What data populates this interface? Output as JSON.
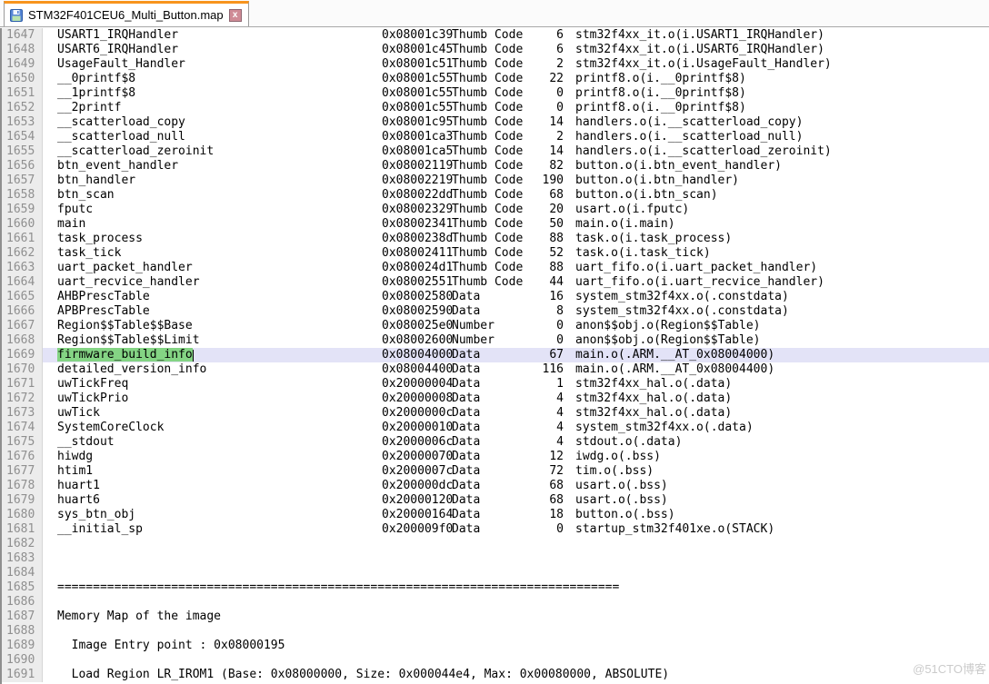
{
  "tab": {
    "title": "STM32F401CEU6_Multi_Button.map",
    "file_icon": "floppy-disk-icon",
    "close_icon": "close-x-icon",
    "close_glyph": "x",
    "accent_color": "#f7941d"
  },
  "colors": {
    "tab_accent_orange": "#f7941d",
    "selection_green": "#84d484",
    "current_line_lavender": "#e3e3f7",
    "gutter_bg": "#ececec",
    "gutter_text": "#8f8f8f",
    "close_button_pink": "#cf8b96",
    "watermark_gray": "#cbcbcb"
  },
  "editor": {
    "first_line": 1647,
    "last_line": 1691,
    "highlighted_line": 1669,
    "selection": {
      "line": 1669,
      "text": "firmware_build_info"
    },
    "symbol_rows": [
      {
        "line": 1647,
        "symbol": "USART1_IRQHandler",
        "address": "0x08001c39",
        "type": "Thumb Code",
        "size": 6,
        "object": "stm32f4xx_it.o(i.USART1_IRQHandler)"
      },
      {
        "line": 1648,
        "symbol": "USART6_IRQHandler",
        "address": "0x08001c45",
        "type": "Thumb Code",
        "size": 6,
        "object": "stm32f4xx_it.o(i.USART6_IRQHandler)"
      },
      {
        "line": 1649,
        "symbol": "UsageFault_Handler",
        "address": "0x08001c51",
        "type": "Thumb Code",
        "size": 2,
        "object": "stm32f4xx_it.o(i.UsageFault_Handler)"
      },
      {
        "line": 1650,
        "symbol": "__0printf$8",
        "address": "0x08001c55",
        "type": "Thumb Code",
        "size": 22,
        "object": "printf8.o(i.__0printf$8)"
      },
      {
        "line": 1651,
        "symbol": "__1printf$8",
        "address": "0x08001c55",
        "type": "Thumb Code",
        "size": 0,
        "object": "printf8.o(i.__0printf$8)"
      },
      {
        "line": 1652,
        "symbol": "__2printf",
        "address": "0x08001c55",
        "type": "Thumb Code",
        "size": 0,
        "object": "printf8.o(i.__0printf$8)"
      },
      {
        "line": 1653,
        "symbol": "__scatterload_copy",
        "address": "0x08001c95",
        "type": "Thumb Code",
        "size": 14,
        "object": "handlers.o(i.__scatterload_copy)"
      },
      {
        "line": 1654,
        "symbol": "__scatterload_null",
        "address": "0x08001ca3",
        "type": "Thumb Code",
        "size": 2,
        "object": "handlers.o(i.__scatterload_null)"
      },
      {
        "line": 1655,
        "symbol": "__scatterload_zeroinit",
        "address": "0x08001ca5",
        "type": "Thumb Code",
        "size": 14,
        "object": "handlers.o(i.__scatterload_zeroinit)"
      },
      {
        "line": 1656,
        "symbol": "btn_event_handler",
        "address": "0x08002119",
        "type": "Thumb Code",
        "size": 82,
        "object": "button.o(i.btn_event_handler)"
      },
      {
        "line": 1657,
        "symbol": "btn_handler",
        "address": "0x08002219",
        "type": "Thumb Code",
        "size": 190,
        "object": "button.o(i.btn_handler)"
      },
      {
        "line": 1658,
        "symbol": "btn_scan",
        "address": "0x080022dd",
        "type": "Thumb Code",
        "size": 68,
        "object": "button.o(i.btn_scan)"
      },
      {
        "line": 1659,
        "symbol": "fputc",
        "address": "0x08002329",
        "type": "Thumb Code",
        "size": 20,
        "object": "usart.o(i.fputc)"
      },
      {
        "line": 1660,
        "symbol": "main",
        "address": "0x08002341",
        "type": "Thumb Code",
        "size": 50,
        "object": "main.o(i.main)"
      },
      {
        "line": 1661,
        "symbol": "task_process",
        "address": "0x0800238d",
        "type": "Thumb Code",
        "size": 88,
        "object": "task.o(i.task_process)"
      },
      {
        "line": 1662,
        "symbol": "task_tick",
        "address": "0x08002411",
        "type": "Thumb Code",
        "size": 52,
        "object": "task.o(i.task_tick)"
      },
      {
        "line": 1663,
        "symbol": "uart_packet_handler",
        "address": "0x080024d1",
        "type": "Thumb Code",
        "size": 88,
        "object": "uart_fifo.o(i.uart_packet_handler)"
      },
      {
        "line": 1664,
        "symbol": "uart_recvice_handler",
        "address": "0x08002551",
        "type": "Thumb Code",
        "size": 44,
        "object": "uart_fifo.o(i.uart_recvice_handler)"
      },
      {
        "line": 1665,
        "symbol": "AHBPrescTable",
        "address": "0x08002580",
        "type": "Data",
        "size": 16,
        "object": "system_stm32f4xx.o(.constdata)"
      },
      {
        "line": 1666,
        "symbol": "APBPrescTable",
        "address": "0x08002590",
        "type": "Data",
        "size": 8,
        "object": "system_stm32f4xx.o(.constdata)"
      },
      {
        "line": 1667,
        "symbol": "Region$$Table$$Base",
        "address": "0x080025e0",
        "type": "Number",
        "size": 0,
        "object": "anon$$obj.o(Region$$Table)"
      },
      {
        "line": 1668,
        "symbol": "Region$$Table$$Limit",
        "address": "0x08002600",
        "type": "Number",
        "size": 0,
        "object": "anon$$obj.o(Region$$Table)"
      },
      {
        "line": 1669,
        "symbol": "firmware_build_info",
        "address": "0x08004000",
        "type": "Data",
        "size": 67,
        "object": "main.o(.ARM.__AT_0x08004000)"
      },
      {
        "line": 1670,
        "symbol": "detailed_version_info",
        "address": "0x08004400",
        "type": "Data",
        "size": 116,
        "object": "main.o(.ARM.__AT_0x08004400)"
      },
      {
        "line": 1671,
        "symbol": "uwTickFreq",
        "address": "0x20000004",
        "type": "Data",
        "size": 1,
        "object": "stm32f4xx_hal.o(.data)"
      },
      {
        "line": 1672,
        "symbol": "uwTickPrio",
        "address": "0x20000008",
        "type": "Data",
        "size": 4,
        "object": "stm32f4xx_hal.o(.data)"
      },
      {
        "line": 1673,
        "symbol": "uwTick",
        "address": "0x2000000c",
        "type": "Data",
        "size": 4,
        "object": "stm32f4xx_hal.o(.data)"
      },
      {
        "line": 1674,
        "symbol": "SystemCoreClock",
        "address": "0x20000010",
        "type": "Data",
        "size": 4,
        "object": "system_stm32f4xx.o(.data)"
      },
      {
        "line": 1675,
        "symbol": "__stdout",
        "address": "0x2000006c",
        "type": "Data",
        "size": 4,
        "object": "stdout.o(.data)"
      },
      {
        "line": 1676,
        "symbol": "hiwdg",
        "address": "0x20000070",
        "type": "Data",
        "size": 12,
        "object": "iwdg.o(.bss)"
      },
      {
        "line": 1677,
        "symbol": "htim1",
        "address": "0x2000007c",
        "type": "Data",
        "size": 72,
        "object": "tim.o(.bss)"
      },
      {
        "line": 1678,
        "symbol": "huart1",
        "address": "0x200000dc",
        "type": "Data",
        "size": 68,
        "object": "usart.o(.bss)"
      },
      {
        "line": 1679,
        "symbol": "huart6",
        "address": "0x20000120",
        "type": "Data",
        "size": 68,
        "object": "usart.o(.bss)"
      },
      {
        "line": 1680,
        "symbol": "sys_btn_obj",
        "address": "0x20000164",
        "type": "Data",
        "size": 18,
        "object": "button.o(.bss)"
      },
      {
        "line": 1681,
        "symbol": "__initial_sp",
        "address": "0x200009f0",
        "type": "Data",
        "size": 0,
        "object": "startup_stm32f401xe.o(STACK)"
      }
    ],
    "text_rows": [
      {
        "line": 1682,
        "text": ""
      },
      {
        "line": 1683,
        "text": ""
      },
      {
        "line": 1684,
        "text": ""
      },
      {
        "line": 1685,
        "text": "==============================================================================="
      },
      {
        "line": 1686,
        "text": ""
      },
      {
        "line": 1687,
        "text": "Memory Map of the image"
      },
      {
        "line": 1688,
        "text": ""
      },
      {
        "line": 1689,
        "text": "  Image Entry point : 0x08000195"
      },
      {
        "line": 1690,
        "text": ""
      },
      {
        "line": 1691,
        "text": "  Load Region LR_IROM1 (Base: 0x08000000, Size: 0x000044e4, Max: 0x00080000, ABSOLUTE)"
      }
    ]
  },
  "watermark": "@51CTO博客"
}
